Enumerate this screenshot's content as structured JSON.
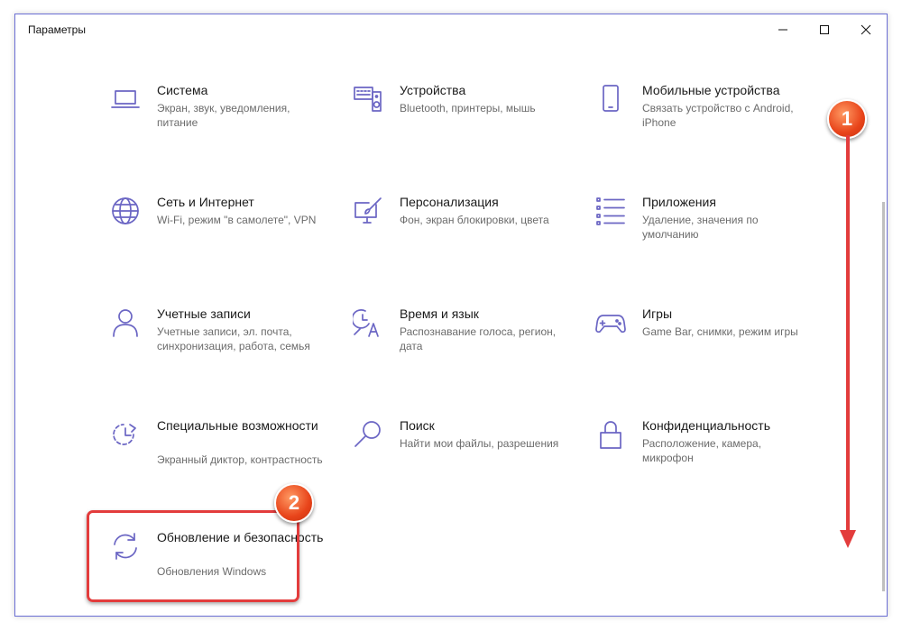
{
  "window": {
    "title": "Параметры"
  },
  "tiles": [
    {
      "name": "Система",
      "desc": "Экран, звук, уведомления, питание",
      "icon": "laptop-icon"
    },
    {
      "name": "Устройства",
      "desc": "Bluetooth, принтеры, мышь",
      "icon": "keyboard-speaker-icon"
    },
    {
      "name": "Мобильные устройства",
      "desc": "Связать устройство с Android, iPhone",
      "icon": "phone-icon"
    },
    {
      "name": "Сеть и Интернет",
      "desc": "Wi-Fi, режим \"в самолете\", VPN",
      "icon": "globe-icon"
    },
    {
      "name": "Персонализация",
      "desc": "Фон, экран блокировки, цвета",
      "icon": "paintbrush-monitor-icon"
    },
    {
      "name": "Приложения",
      "desc": "Удаление, значения по умолчанию",
      "icon": "list-icon"
    },
    {
      "name": "Учетные записи",
      "desc": "Учетные записи, эл. почта, синхронизация, работа, семья",
      "icon": "person-icon"
    },
    {
      "name": "Время и язык",
      "desc": "Распознавание голоса, регион, дата",
      "icon": "time-language-icon"
    },
    {
      "name": "Игры",
      "desc": "Game Bar, снимки, режим игры",
      "icon": "gamepad-icon"
    },
    {
      "name": "Специальные возможности",
      "desc": "Экранный диктор, контрастность",
      "icon": "ease-of-access-icon"
    },
    {
      "name": "Поиск",
      "desc": "Найти мои файлы, разрешения",
      "icon": "search-icon"
    },
    {
      "name": "Конфиденциальность",
      "desc": "Расположение, камера, микрофон",
      "icon": "lock-icon"
    },
    {
      "name": "Обновление и безопасность",
      "desc": "Обновления Windows",
      "icon": "sync-icon"
    }
  ],
  "annotations": {
    "badge1": "1",
    "badge2": "2"
  },
  "colors": {
    "accent": "#6b66c4",
    "highlight": "#e33c3c",
    "badge": "#e8441a"
  }
}
